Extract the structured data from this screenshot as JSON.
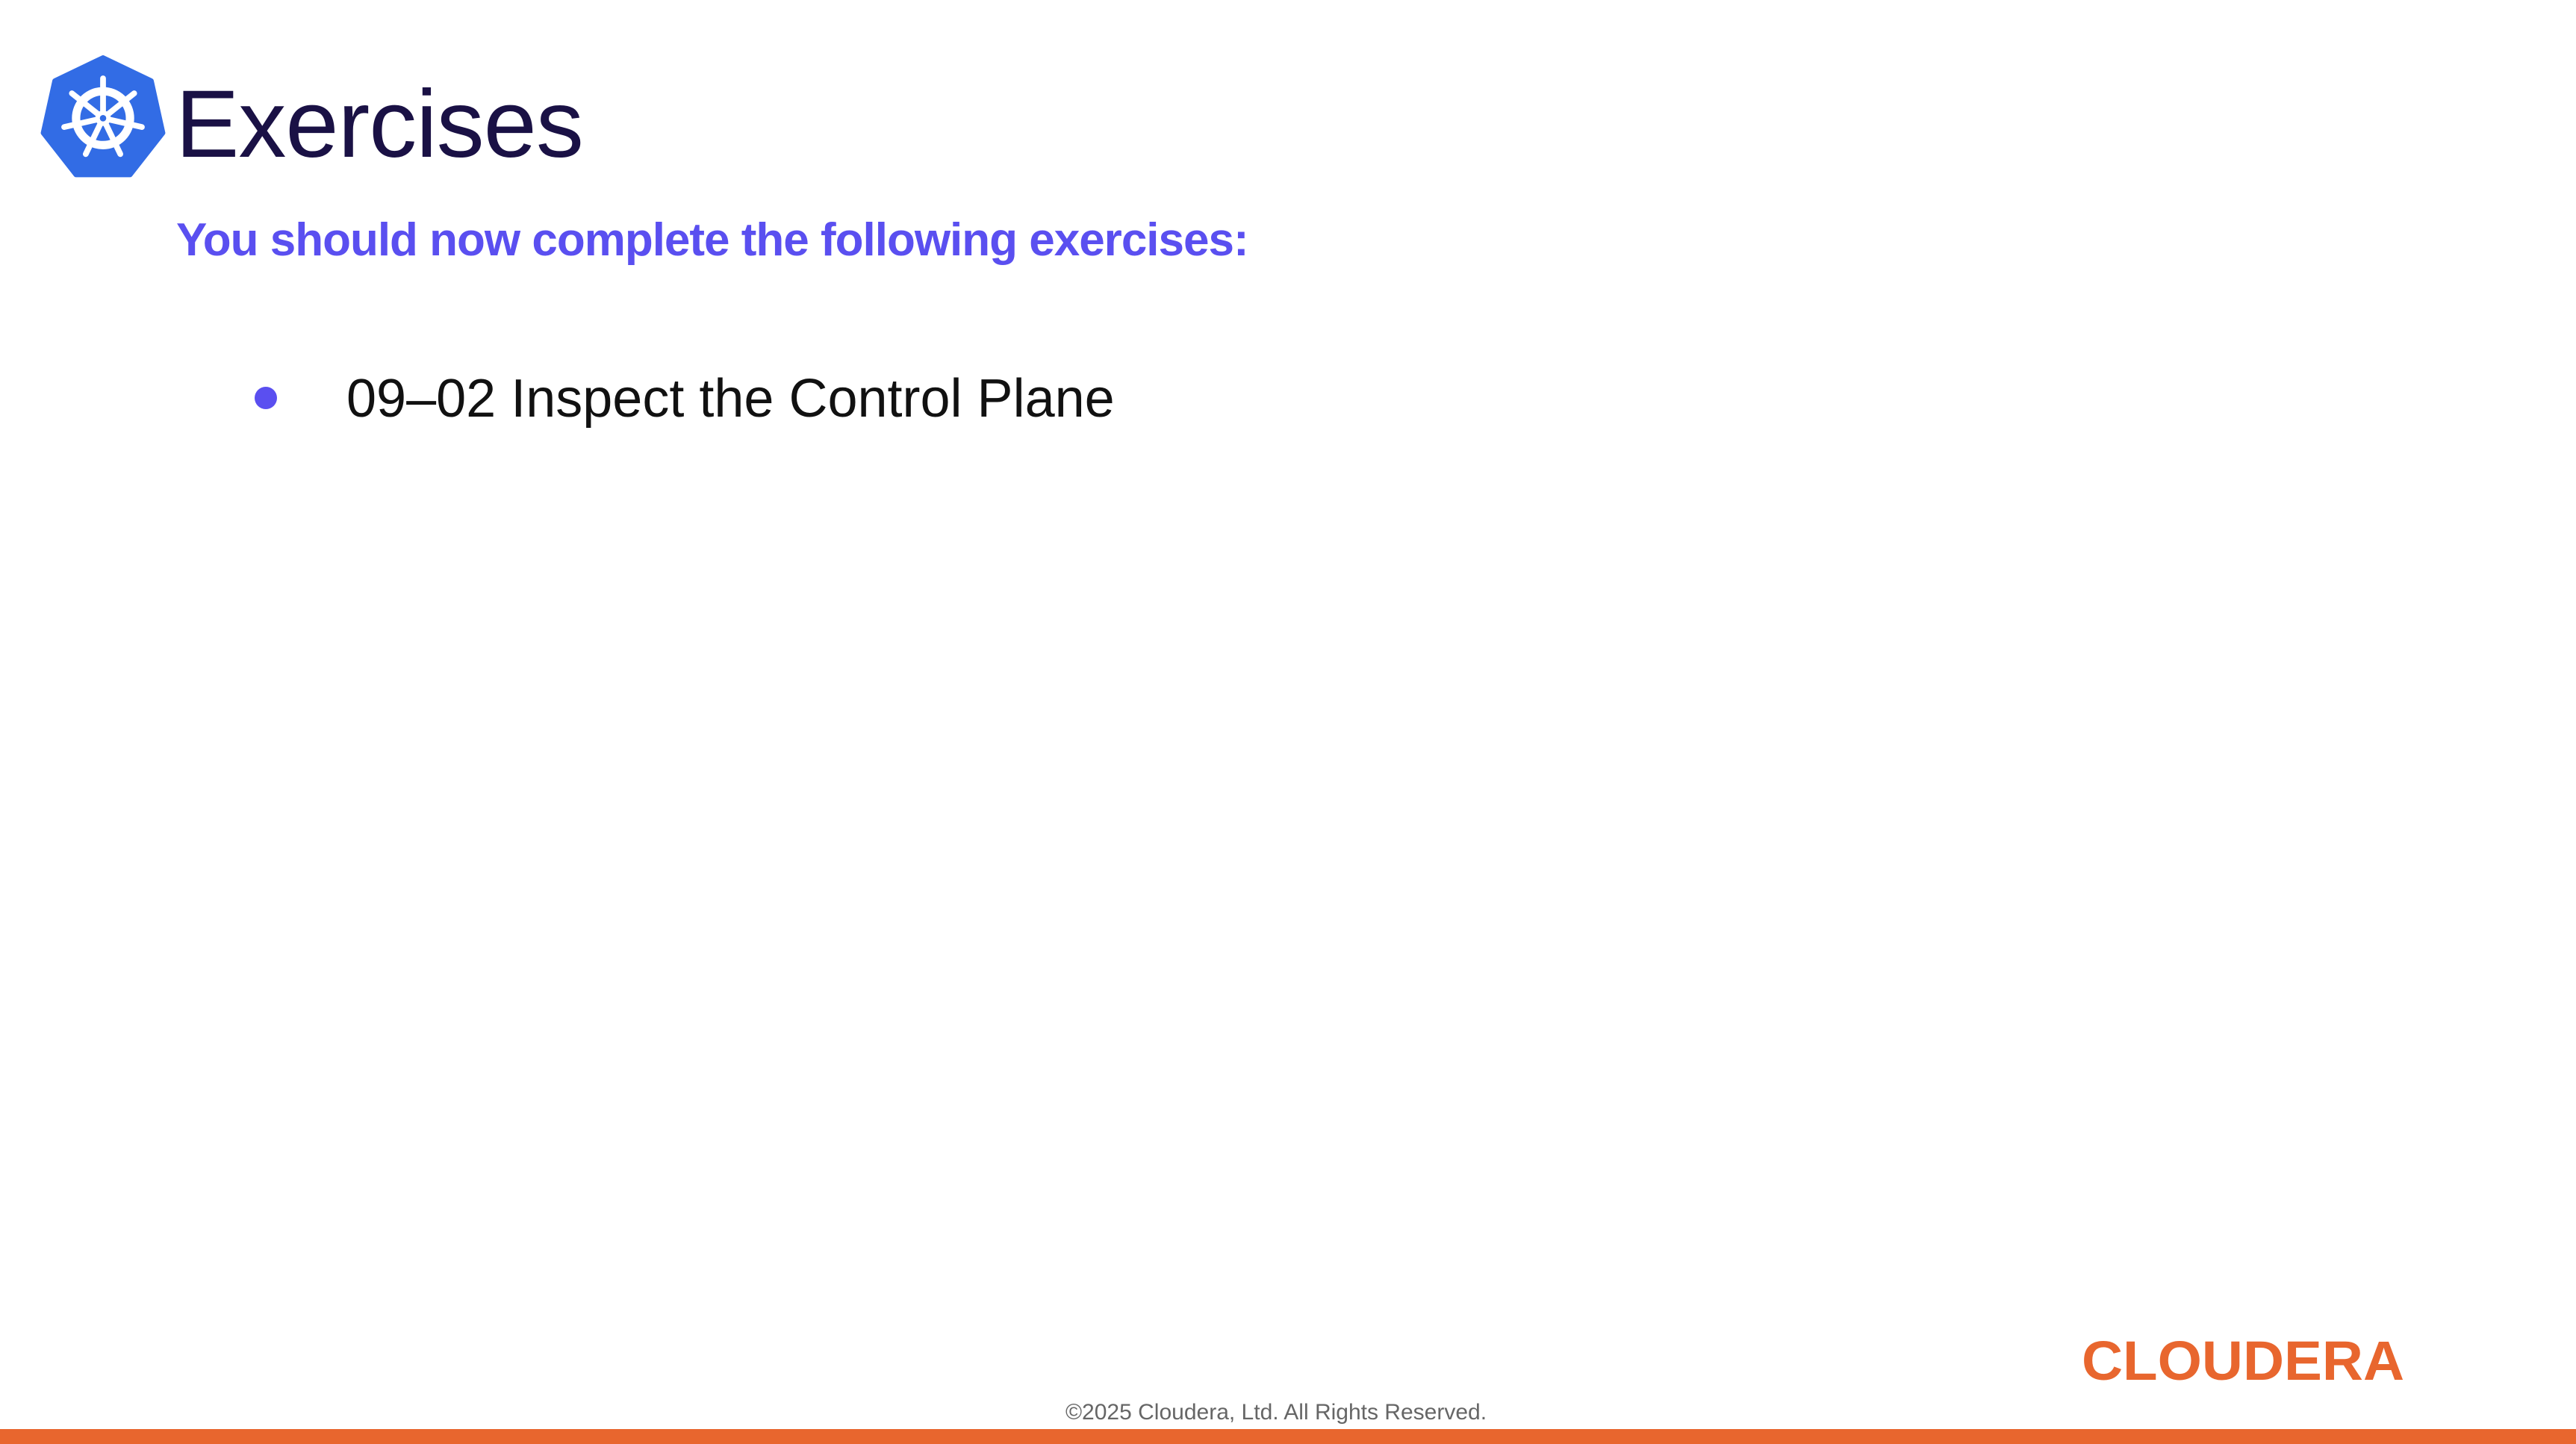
{
  "slide": {
    "title": "Exercises",
    "subtitle": "You should now complete the following exercises:",
    "exercises": [
      "09–02 Inspect the Control Plane"
    ]
  },
  "footer": {
    "copyright": "©2025 Cloudera, Ltd. All Rights Reserved.",
    "brand": "CLOUDERA"
  },
  "icons": {
    "title_icon": "kubernetes-helm-icon",
    "bullet": "bullet-dot"
  },
  "colors": {
    "title": "#1a1145",
    "accent": "#5a4ff0",
    "kubernetes_blue": "#326ce5",
    "brand_orange": "#e8662e",
    "footer_text": "#666666"
  }
}
